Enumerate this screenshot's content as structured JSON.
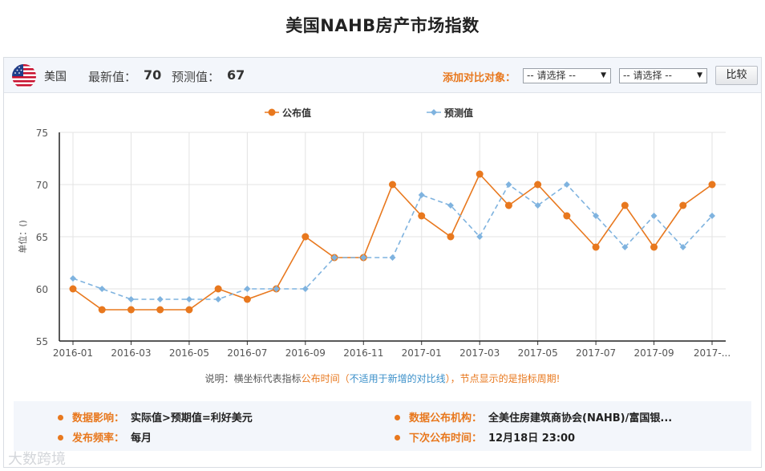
{
  "page": {
    "title": "美国NAHB房产市场指数"
  },
  "header": {
    "country": "美国",
    "latest_label": "最新值：",
    "latest_value": "70",
    "forecast_label": "预测值：",
    "forecast_value": "67",
    "compare_label": "添加对比对象：",
    "select1": "-- 请选择 --",
    "select2": "-- 请选择 --",
    "compare_button": "比较"
  },
  "colors": {
    "published": "#e8781e",
    "forecast": "#7fb3df",
    "accent": "#e8781e"
  },
  "chart_data": {
    "type": "line",
    "ylabel": "单位：()",
    "ylim": [
      55,
      75
    ],
    "yticks": [
      55,
      60,
      65,
      70,
      75
    ],
    "x": [
      "2016-01",
      "2016-02",
      "2016-03",
      "2016-04",
      "2016-05",
      "2016-06",
      "2016-07",
      "2016-08",
      "2016-09",
      "2016-10",
      "2016-11",
      "2016-12",
      "2017-01",
      "2017-02",
      "2017-03",
      "2017-04",
      "2017-05",
      "2017-06",
      "2017-07",
      "2017-08",
      "2017-09",
      "2017-10",
      "2017-11"
    ],
    "xtick_labels": [
      "2016-01",
      "2016-03",
      "2016-05",
      "2016-07",
      "2016-09",
      "2016-11",
      "2017-01",
      "2017-03",
      "2017-05",
      "2017-07",
      "2017-09",
      "2017-..."
    ],
    "series": [
      {
        "name": "公布值",
        "values": [
          60,
          58,
          58,
          58,
          58,
          60,
          59,
          60,
          65,
          63,
          63,
          70,
          67,
          65,
          71,
          68,
          70,
          67,
          64,
          68,
          64,
          68,
          70
        ]
      },
      {
        "name": "预测值",
        "values": [
          61,
          60,
          59,
          59,
          59,
          59,
          60,
          60,
          60,
          63,
          63,
          63,
          69,
          68,
          65,
          70,
          68,
          70,
          67,
          64,
          67,
          64,
          67
        ]
      }
    ],
    "legend_position": "top-center",
    "grid": true
  },
  "note": {
    "p1": "说明：横坐标代表指标",
    "p2": "公布时间",
    "p3": "（",
    "p4": "不适用于新增的对比线",
    "p5": "），节点显示的是",
    "p6": "指标周期",
    "p7": "!"
  },
  "info": {
    "impact_label": "数据影响：",
    "impact_value": "实际值>预期值=利好美元",
    "agency_label": "数据公布机构：",
    "agency_value": "全美住房建筑商协会(NAHB)/富国银...",
    "freq_label": "发布频率：",
    "freq_value": "每月",
    "next_label": "下次公布时间：",
    "next_value": "12月18日 23:00"
  },
  "watermark": "大数跨境"
}
